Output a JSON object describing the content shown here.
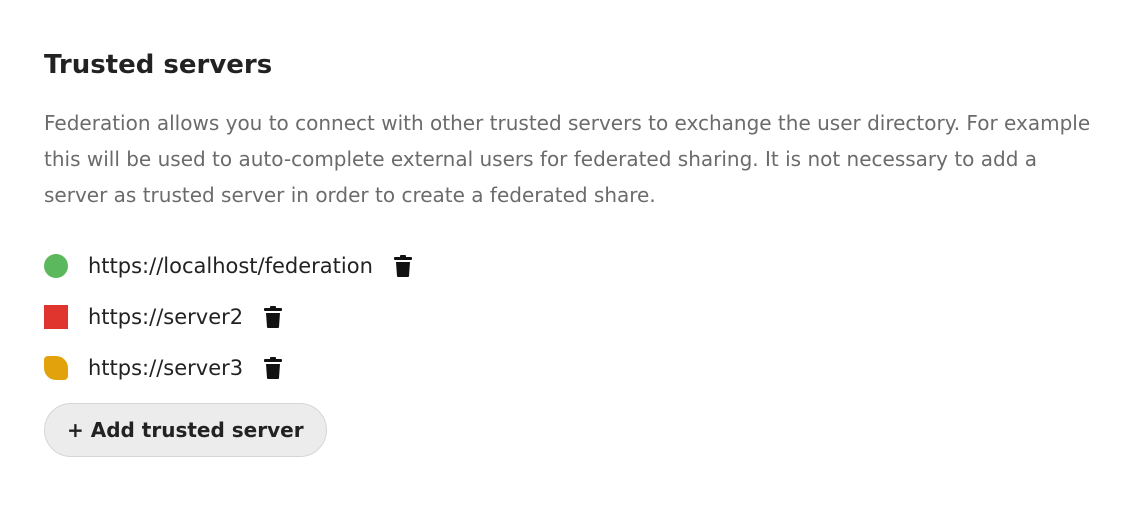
{
  "section": {
    "title": "Trusted servers",
    "description": "Federation allows you to connect with other trusted servers to exchange the user directory. For example this will be used to auto-complete external users for federated sharing. It is not necessary to add a server as trusted server in order to create a federated share."
  },
  "servers": [
    {
      "url": "https://localhost/federation",
      "status": "ok",
      "status_color": "#5cb85c",
      "delete_icon": "trash-icon"
    },
    {
      "url": "https://server2",
      "status": "failure",
      "status_color": "#e0342e",
      "delete_icon": "trash-icon"
    },
    {
      "url": "https://server3",
      "status": "indeterminate",
      "status_color": "#e2a20b",
      "delete_icon": "trash-icon"
    }
  ],
  "add_button": {
    "label": "+ Add trusted server"
  }
}
